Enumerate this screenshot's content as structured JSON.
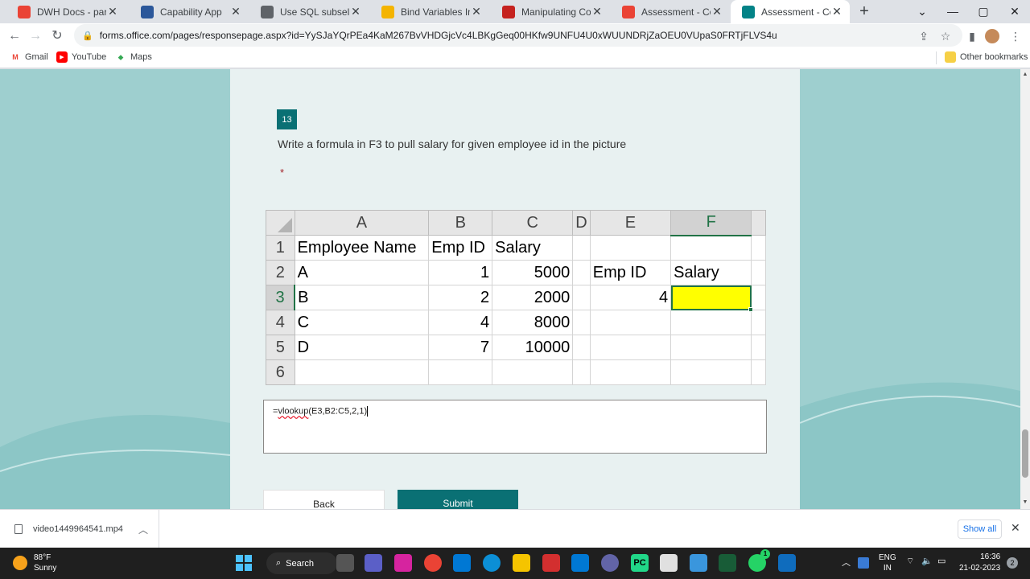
{
  "tabs": [
    {
      "title": "DWH Docs - paradhan",
      "icon": "gmail-icon",
      "color": "#ea4335"
    },
    {
      "title": "Capability App",
      "icon": "app-icon",
      "color": "#2b579a"
    },
    {
      "title": "Use SQL subselects to",
      "icon": "wave-icon",
      "color": "#5f6368"
    },
    {
      "title": "Bind Variables In PL/SQL",
      "icon": "mask-icon",
      "color": "#f4b400"
    },
    {
      "title": "Manipulating Comma",
      "icon": "video-icon",
      "color": "#c5221f"
    },
    {
      "title": "Assessment - Concern",
      "icon": "gmail-icon",
      "color": "#ea4335"
    },
    {
      "title": "Assessment - Concern",
      "icon": "forms-icon",
      "color": "#038387"
    }
  ],
  "window": {
    "minimize": "—",
    "maximize": "▢",
    "close": "✕",
    "dropdown": "⌄"
  },
  "address": {
    "url": "forms.office.com/pages/responsepage.aspx?id=YySJaYQrPEa4KaM267BvVHDGjcVc4LBKgGeq00HKfw9UNFU4U0xWUUNDRjZaOEU0VUpaS0FRTjFLVS4u"
  },
  "bookmarks": [
    {
      "label": "Gmail",
      "icon": "gmail-icon"
    },
    {
      "label": "YouTube",
      "icon": "youtube-icon"
    },
    {
      "label": "Maps",
      "icon": "maps-icon"
    }
  ],
  "other_bookmarks": "Other bookmarks",
  "question": {
    "number": "13",
    "text": "Write a formula in F3 to pull salary for given employee id in the picture",
    "required_mark": "*"
  },
  "sheet": {
    "col_headers": [
      "A",
      "B",
      "C",
      "D",
      "E",
      "F"
    ],
    "selected_col": "F",
    "selected_row": "3",
    "rows": [
      {
        "n": "1",
        "cells": [
          "Employee Name",
          "Emp ID",
          "Salary",
          "",
          "",
          ""
        ]
      },
      {
        "n": "2",
        "cells": [
          "A",
          "1",
          "5000",
          "",
          "Emp ID",
          "Salary"
        ]
      },
      {
        "n": "3",
        "cells": [
          "B",
          "2",
          "2000",
          "",
          "4",
          ""
        ]
      },
      {
        "n": "4",
        "cells": [
          "C",
          "4",
          "8000",
          "",
          "",
          ""
        ]
      },
      {
        "n": "5",
        "cells": [
          "D",
          "7",
          "10000",
          "",
          "",
          ""
        ]
      },
      {
        "n": "6",
        "cells": [
          "",
          "",
          "",
          "",
          "",
          ""
        ]
      }
    ],
    "highlight_color": "#ffff00"
  },
  "answer": {
    "prefix": "=",
    "word": "vlookup",
    "rest": "(E3,B2:C5,2,1)"
  },
  "buttons": {
    "back": "Back",
    "submit": "Submit"
  },
  "download": {
    "file": "video1449964541.mp4",
    "show_all": "Show all"
  },
  "taskbar": {
    "temp": "88°F",
    "weather": "Sunny",
    "search": "Search",
    "lang1": "ENG",
    "lang2": "IN",
    "time": "16:36",
    "date": "21-02-2023",
    "notifications": "2",
    "whatsapp_badge": "1"
  }
}
